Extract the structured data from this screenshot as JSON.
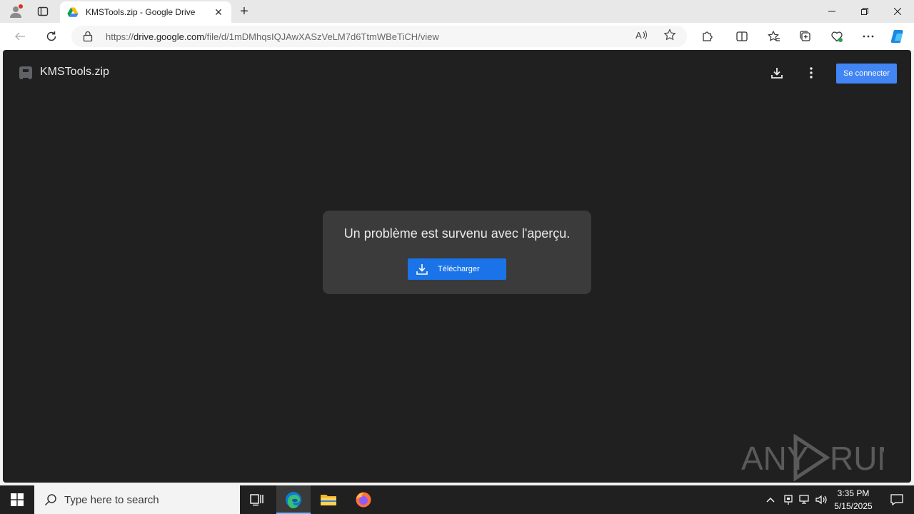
{
  "browser": {
    "tab": {
      "title": "KMSTools.zip - Google Drive",
      "close_icon": "close-icon"
    },
    "new_tab_label": "+",
    "url": {
      "scheme": "https://",
      "host": "drive.google.com",
      "path": "/file/d/1mDMhqsIQJAwXASzVeLM7d6TtmWBeTiCH/view"
    }
  },
  "drive": {
    "filename": "KMSTools.zip",
    "signin_label": "Se connecter",
    "preview_error": "Un problème est survenu avec l'aperçu.",
    "download_label": "Télécharger",
    "accent": "#4285f4",
    "button_blue": "#1a73e8"
  },
  "watermark": {
    "text": "ANY RUN"
  },
  "taskbar": {
    "search_placeholder": "Type here to search",
    "time": "3:35 PM",
    "date": "5/15/2025"
  }
}
